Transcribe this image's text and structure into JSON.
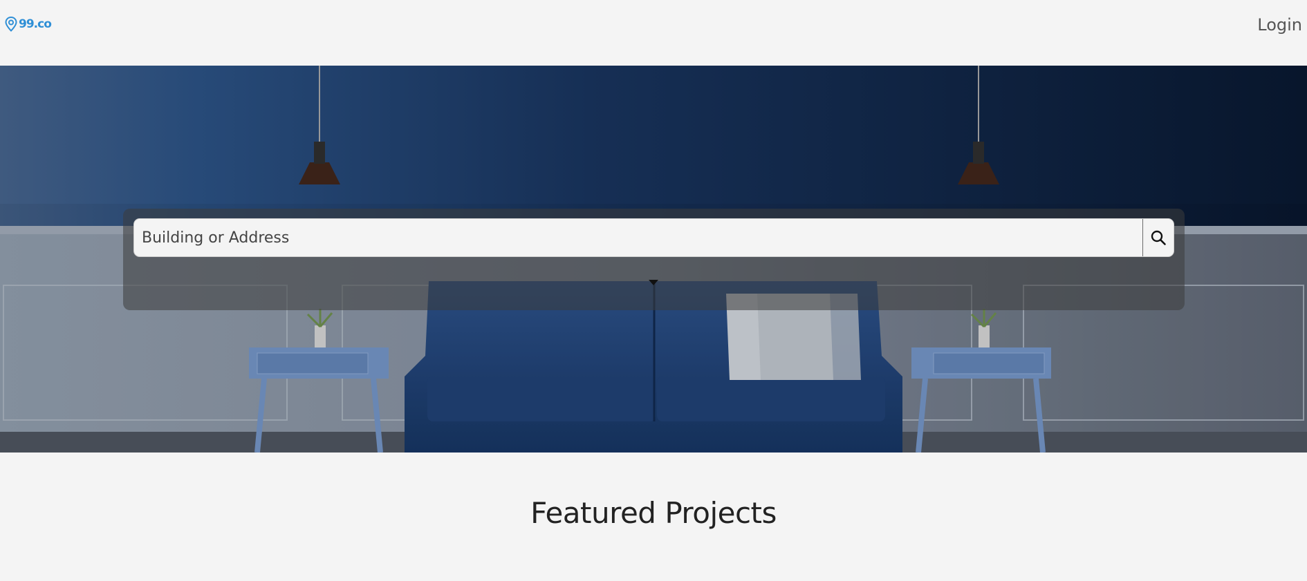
{
  "header": {
    "logo_text": "99.co",
    "logo_icon": "map-pin-icon",
    "login_label": "Login"
  },
  "hero": {
    "background": "living-room-photo",
    "search": {
      "placeholder": "Building or Address",
      "value": "",
      "button_icon": "search-icon"
    },
    "toggle_icon": "caret-down-icon"
  },
  "main": {
    "section_title": "Featured Projects"
  },
  "colors": {
    "brand": "#2f8fd6",
    "page_bg": "#f4f4f4",
    "hero_wall": "#14325e"
  }
}
